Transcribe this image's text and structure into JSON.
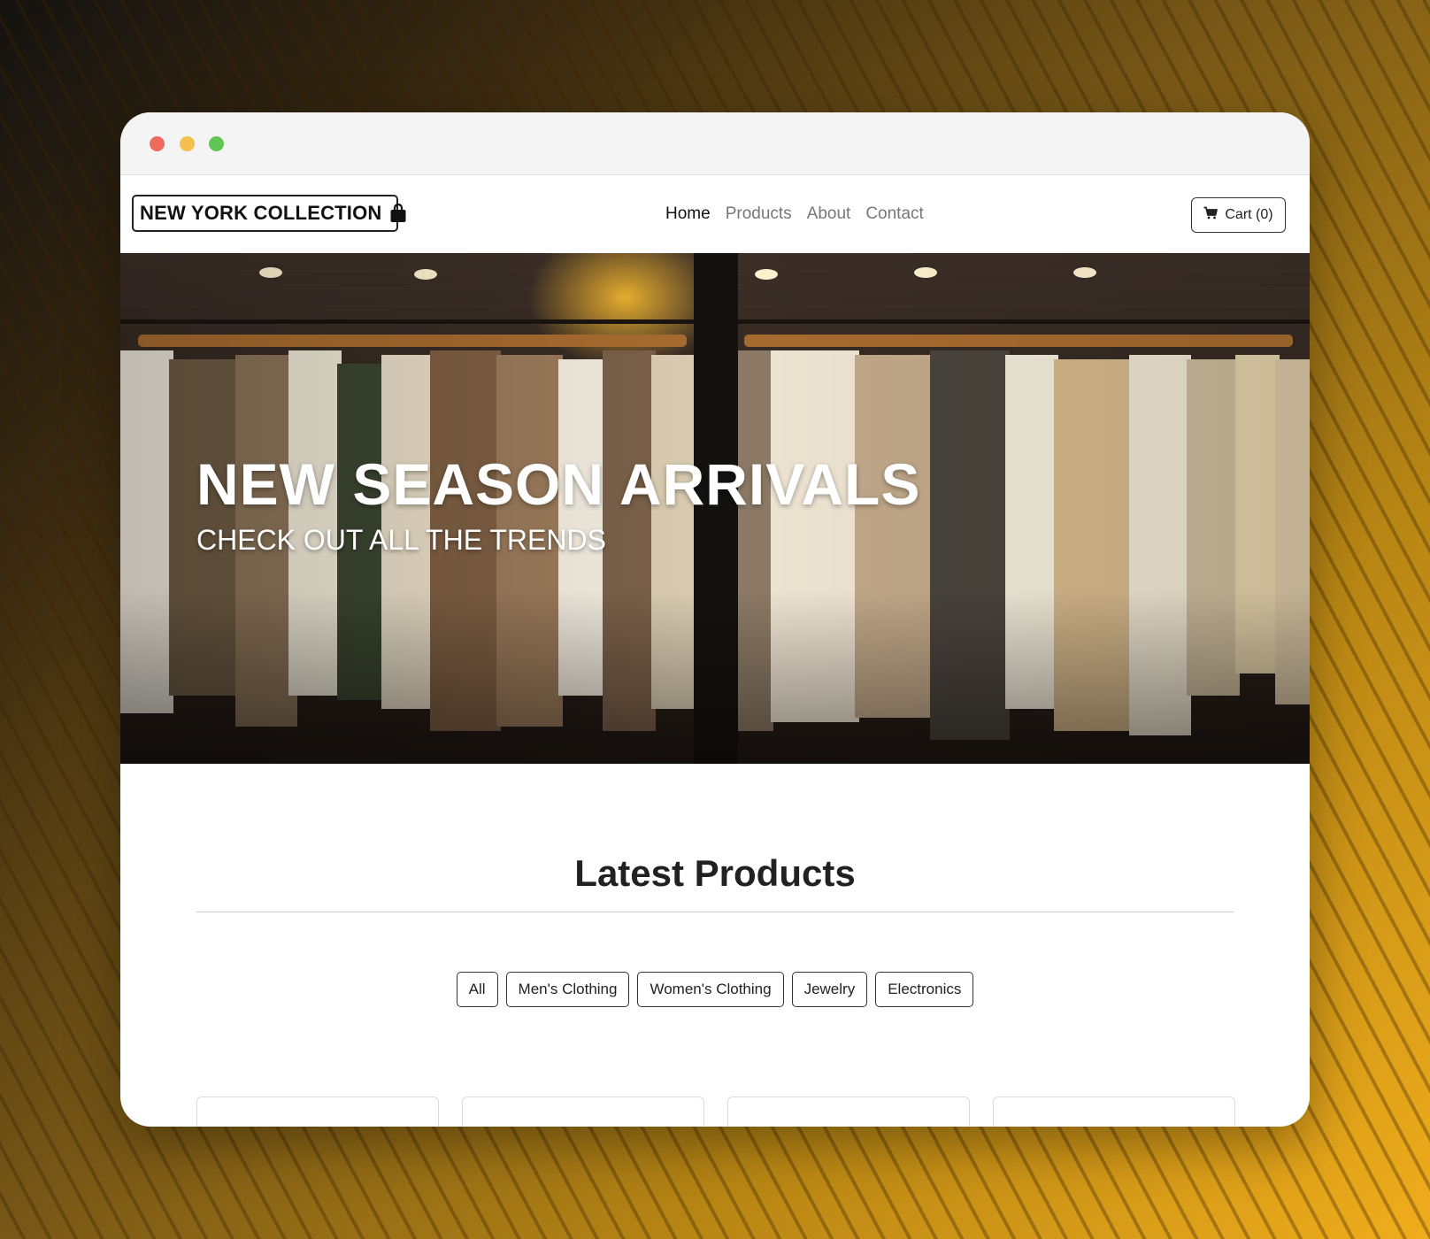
{
  "brand": {
    "name": "NEW YORK COLLECTION",
    "icon": "shopping-bag-icon"
  },
  "nav": {
    "links": [
      {
        "label": "Home",
        "active": true
      },
      {
        "label": "Products",
        "active": false
      },
      {
        "label": "About",
        "active": false
      },
      {
        "label": "Contact",
        "active": false
      }
    ],
    "cart_label": "Cart (0)",
    "cart_icon": "cart-icon"
  },
  "hero": {
    "title": "NEW SEASON ARRIVALS",
    "subtitle": "CHECK OUT ALL THE TRENDS"
  },
  "products": {
    "heading": "Latest Products",
    "filters": [
      "All",
      "Men's Clothing",
      "Women's Clothing",
      "Jewelry",
      "Electronics"
    ]
  },
  "colors": {
    "window_dot_red": "#ed6a5e",
    "window_dot_yellow": "#f4bf4f",
    "window_dot_green": "#61c554",
    "text_dark": "#212121",
    "nav_muted": "#777777"
  }
}
